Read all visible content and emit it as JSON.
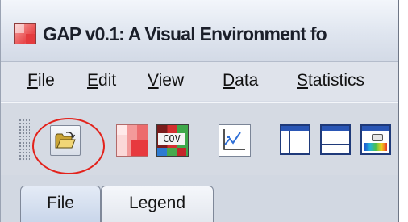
{
  "window": {
    "title": "GAP v0.1: A Visual Environment fo"
  },
  "menubar": {
    "items": [
      {
        "mnemonic": "F",
        "rest": "ile"
      },
      {
        "mnemonic": "E",
        "rest": "dit"
      },
      {
        "mnemonic": "V",
        "rest": "iew"
      },
      {
        "mnemonic": "D",
        "rest": "ata"
      },
      {
        "mnemonic": "S",
        "rest": "tatistics"
      }
    ]
  },
  "toolbar": {
    "buttons": [
      {
        "icon": "open-folder-icon"
      },
      {
        "icon": "heatmap-icon"
      },
      {
        "icon": "covariance-icon",
        "label": "COV"
      },
      {
        "icon": "line-chart-icon"
      },
      {
        "icon": "layout-left-panel-icon"
      },
      {
        "icon": "layout-bottom-panel-icon"
      },
      {
        "icon": "color-settings-icon"
      }
    ],
    "highlight_color": "#e3221b"
  },
  "tabs": [
    {
      "label": "File",
      "selected": true
    },
    {
      "label": "Legend",
      "selected": false
    }
  ]
}
